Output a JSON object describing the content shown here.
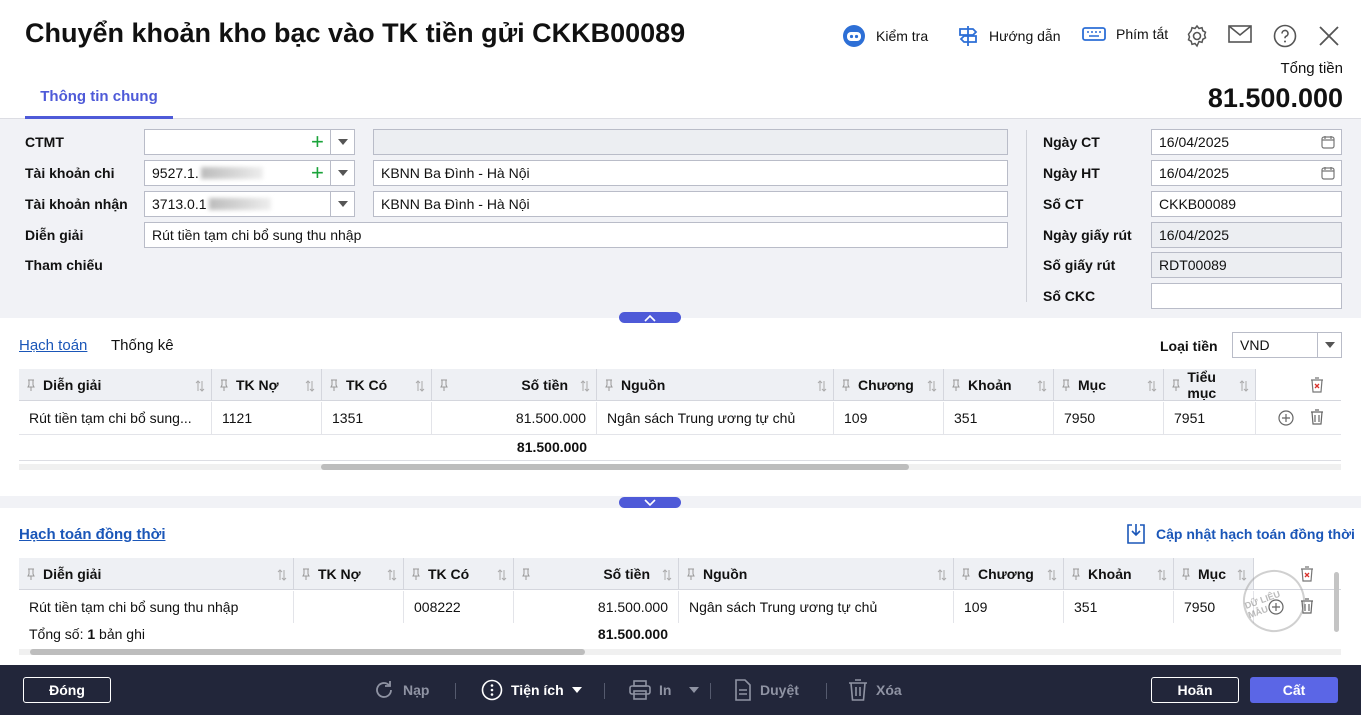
{
  "header": {
    "title": "Chuyển khoản kho bạc vào TK tiền gửi CKKB00089",
    "toolbar": {
      "check": "Kiểm tra",
      "guide": "Hướng dẫn",
      "shortcuts": "Phím tắt"
    },
    "total_label": "Tổng tiền",
    "total_value": "81.500.000",
    "tab_general": "Thông tin chung"
  },
  "form": {
    "ctmt_label": "CTMT",
    "ctmt_value": "",
    "ctmt_name": "",
    "pay_account_label": "Tài khoản chi",
    "pay_account_value": "9527.1.",
    "pay_account_name": "KBNN Ba Đình - Hà Nội",
    "recv_account_label": "Tài khoản nhận",
    "recv_account_value": "3713.0.1",
    "recv_account_name": "KBNN Ba Đình - Hà Nội",
    "description_label": "Diễn giải",
    "description_value": "Rút tiền tạm chi bổ sung thu nhập",
    "reference_label": "Tham chiếu",
    "doc_date_label": "Ngày CT",
    "doc_date_value": "16/04/2025",
    "post_date_label": "Ngày HT",
    "post_date_value": "16/04/2025",
    "doc_no_label": "Số CT",
    "doc_no_value": "CKKB00089",
    "withdraw_date_label": "Ngày giấy rút",
    "withdraw_date_value": "16/04/2025",
    "withdraw_no_label": "Số giấy rút",
    "withdraw_no_value": "RDT00089",
    "ckc_label": "Số CKC",
    "ckc_value": ""
  },
  "accounting": {
    "tab_accounting": "Hạch toán",
    "tab_stats": "Thống kê",
    "currency_label": "Loại tiền",
    "currency_value": "VND",
    "columns": [
      "Diễn giải",
      "TK Nợ",
      "TK Có",
      "Số tiền",
      "Nguồn",
      "Chương",
      "Khoản",
      "Mục",
      "Tiểu mục"
    ],
    "row": [
      "Rút tiền tạm chi bổ sung...",
      "1121",
      "1351",
      "81.500.000",
      "Ngân sách Trung ương tự chủ",
      "109",
      "351",
      "7950",
      "7951"
    ],
    "total": "81.500.000"
  },
  "concurrent": {
    "title": "Hạch toán đồng thời",
    "update_label": "Cập nhật hạch toán đồng thời",
    "columns": [
      "Diễn giải",
      "TK Nợ",
      "TK Có",
      "Số tiền",
      "Nguồn",
      "Chương",
      "Khoản",
      "Mục"
    ],
    "row": [
      "Rút tiền tạm chi bổ sung thu nhập",
      "",
      "008222",
      "81.500.000",
      "Ngân sách Trung ương tự chủ",
      "109",
      "351",
      "7950"
    ],
    "count_prefix": "Tổng số: ",
    "count_value": "1",
    "count_suffix": " bản ghi",
    "total": "81.500.000",
    "watermark": "DỮ LIỆU MẪU"
  },
  "footer": {
    "close": "Đóng",
    "load": "Nạp",
    "utilities": "Tiện ích",
    "print": "In",
    "approve": "Duyệt",
    "delete": "Xóa",
    "cancel": "Hoãn",
    "save": "Cất"
  },
  "colors": {
    "accent": "#4e5ad8",
    "footer_bg": "#22263a",
    "link": "#1a56b8",
    "add_green": "#1aa33a"
  }
}
